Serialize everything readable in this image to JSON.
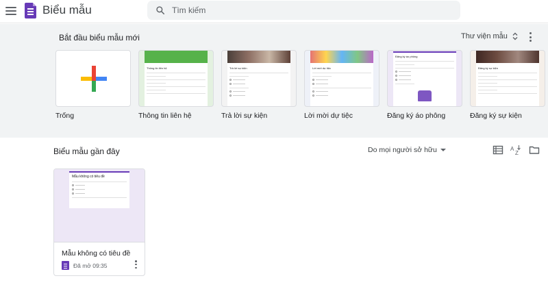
{
  "header": {
    "app_title": "Biểu mẫu",
    "search_placeholder": "Tìm kiếm"
  },
  "templates": {
    "section_title": "Bắt đầu biểu mẫu mới",
    "gallery_label": "Thư viện mẫu",
    "items": [
      {
        "label": "Trống",
        "thumb_title": ""
      },
      {
        "label": "Thông tin liên hệ",
        "thumb_title": "Thông tin liên hệ"
      },
      {
        "label": "Trả lời sự kiện",
        "thumb_title": "Trả lời sự kiện"
      },
      {
        "label": "Lời mời dự tiệc",
        "thumb_title": "Lời mời dự tiệc"
      },
      {
        "label": "Đăng ký áo phông",
        "thumb_title": "Đăng ký áo phông"
      },
      {
        "label": "Đăng ký sự kiện",
        "thumb_title": "Đăng ký sự kiện"
      }
    ]
  },
  "recent": {
    "section_title": "Biểu mẫu gần đây",
    "owner_filter": "Do mọi người sở hữu",
    "docs": [
      {
        "name": "Mẫu không có tiêu đề",
        "meta": "Đã mở 09:35",
        "thumb_title": "Mẫu không có tiêu đề"
      }
    ]
  },
  "colors": {
    "brand": "#673ab7",
    "surface": "#f1f3f4",
    "plus_red": "#ea4335",
    "plus_blue": "#4285f4",
    "plus_green": "#34a853",
    "plus_yellow": "#fbbc04"
  }
}
